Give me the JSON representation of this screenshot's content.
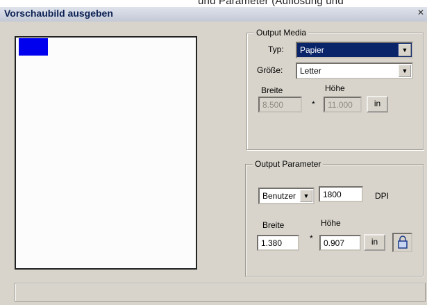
{
  "top_crop_text": "und Parameter (Auflösung und",
  "window": {
    "title": "Vorschaubild ausgeben",
    "close_glyph": "✕"
  },
  "output_media": {
    "legend": "Output Media",
    "type_label": "Typ:",
    "type_value": "Papier",
    "size_label": "Größe:",
    "size_value": "Letter",
    "width_label": "Breite",
    "height_label": "Höhe",
    "width_value": "8.500",
    "times": "*",
    "height_value": "11.000",
    "unit_button": "in"
  },
  "output_parameter": {
    "legend": "Output Parameter",
    "mode_value": "Benutzer",
    "dpi_value": "1800",
    "dpi_label": "DPI",
    "width_label": "Breite",
    "height_label": "Höhe",
    "width_value": "1.380",
    "times": "*",
    "height_value": "0.907",
    "unit_button": "in",
    "lock_icon": "lock-icon"
  },
  "colors": {
    "preview_mark": "#0000ee",
    "selected": "#0a246a",
    "dialog_bg": "#d8d4cb"
  }
}
